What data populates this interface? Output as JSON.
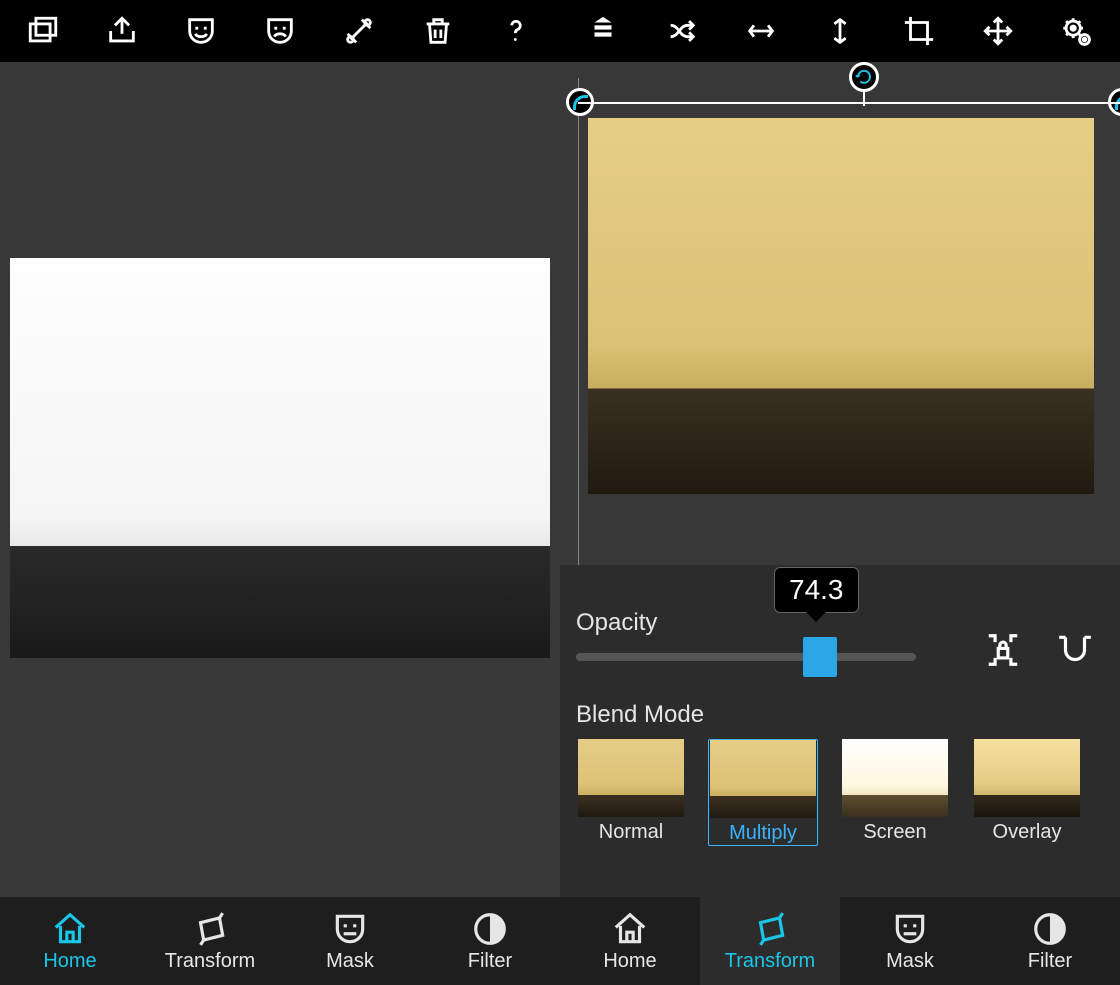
{
  "left": {
    "toolbar_icons": [
      "layers",
      "share",
      "mask-happy",
      "mask-sad",
      "tools",
      "trash",
      "help"
    ],
    "nav": [
      {
        "key": "home",
        "label": "Home",
        "active": true
      },
      {
        "key": "transform",
        "label": "Transform",
        "active": false
      },
      {
        "key": "mask",
        "label": "Mask",
        "active": false
      },
      {
        "key": "filter",
        "label": "Filter",
        "active": false
      }
    ]
  },
  "right": {
    "toolbar_icons": [
      "stack",
      "shuffle",
      "flip-h",
      "flip-v",
      "crop",
      "move",
      "settings"
    ],
    "opacity": {
      "label": "Opacity",
      "value": "74.3",
      "slider_pct": 74.3
    },
    "blend": {
      "label": "Blend Mode",
      "options": [
        {
          "key": "normal",
          "label": "Normal"
        },
        {
          "key": "multiply",
          "label": "Multiply",
          "active": true
        },
        {
          "key": "screen",
          "label": "Screen"
        },
        {
          "key": "overlay",
          "label": "Overlay"
        }
      ]
    },
    "nav": [
      {
        "key": "home",
        "label": "Home",
        "active": false
      },
      {
        "key": "transform",
        "label": "Transform",
        "active": true
      },
      {
        "key": "mask",
        "label": "Mask",
        "active": false
      },
      {
        "key": "filter",
        "label": "Filter",
        "active": false
      }
    ]
  }
}
